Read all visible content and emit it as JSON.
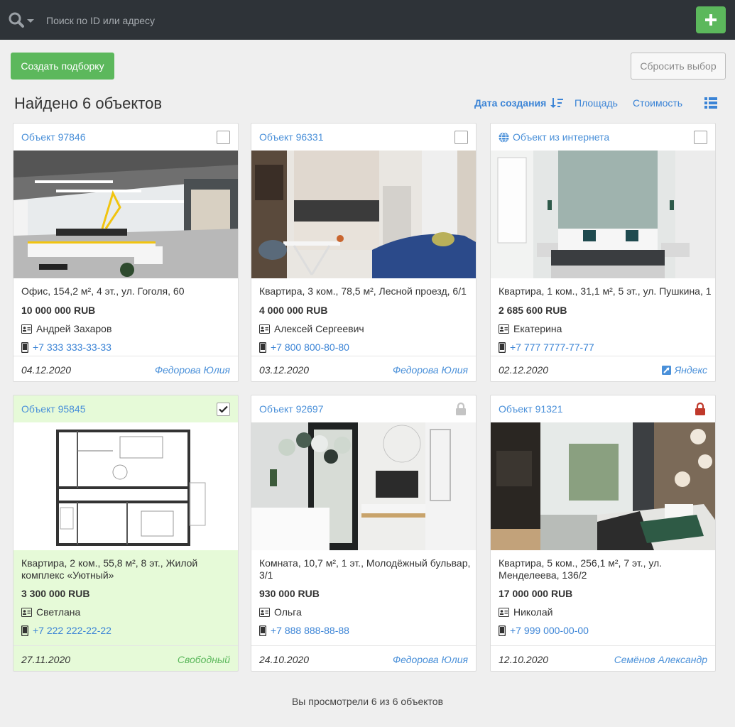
{
  "search": {
    "placeholder": "Поиск по ID или адресу"
  },
  "toolbar": {
    "create_label": "Создать подборку",
    "reset_label": "Сбросить выбор"
  },
  "results": {
    "found_label": "Найдено 6 объектов",
    "viewed_label": "Вы просмотрели 6 из 6 объектов"
  },
  "sort": {
    "active_label": "Дата создания",
    "options": [
      "Площадь",
      "Стоимость"
    ]
  },
  "colors": {
    "topbar": "#2e3338",
    "accent_green": "#5cb85c",
    "link_blue": "#4a90d9",
    "selected_bg": "#e6fad8",
    "lock_red": "#c0392b"
  },
  "cards": [
    {
      "id_label": "Объект 97846",
      "desc": "Офис, 154,2 м², 4 эт., ул. Гоголя, 60",
      "price": "10 000 000 RUB",
      "contact": "Андрей Захаров",
      "phone": "+7 333 333-33-33",
      "date": "04.12.2020",
      "agent": "Федорова Юлия",
      "selected": false,
      "lock": "none",
      "source": "none",
      "image_type": "office"
    },
    {
      "id_label": "Объект 96331",
      "desc": "Квартира, 3 ком., 78,5 м², Лесной проезд, 6/1",
      "price": "4 000 000 RUB",
      "contact": "Алексей Сергеевич",
      "phone": "+7 800 800-80-80",
      "date": "03.12.2020",
      "agent": "Федорова Юлия",
      "selected": false,
      "lock": "none",
      "source": "none",
      "image_type": "kitchen"
    },
    {
      "id_label": "Объект из интернета",
      "desc": "Квартира, 1 ком., 31,1 м², 5 эт.,  ул. Пушкина, 1",
      "price": "2 685 600 RUB",
      "contact": "Екатерина",
      "phone": "+7 777 7777-77-77",
      "date": "02.12.2020",
      "agent": "Яндекс",
      "selected": false,
      "lock": "none",
      "source": "internet",
      "image_type": "bedroom"
    },
    {
      "id_label": "Объект 95845",
      "desc": "Квартира, 2 ком., 55,8 м², 8 эт., Жилой комплекс «Уютный»",
      "price": "3 300 000 RUB",
      "contact": "Светлана",
      "phone": "+7 222 222-22-22",
      "date": "27.11.2020",
      "agent": "Свободный",
      "selected": true,
      "lock": "none",
      "source": "none",
      "image_type": "plan"
    },
    {
      "id_label": "Объект 92697",
      "desc": "Комната, 10,7 м², 1 эт., Молодёжный бульвар, 3/1",
      "price": "930 000 RUB",
      "contact": "Ольга",
      "phone": "+7 888 888-88-88",
      "date": "24.10.2020",
      "agent": "Федорова Юлия",
      "selected": false,
      "lock": "grey",
      "source": "none",
      "image_type": "living"
    },
    {
      "id_label": "Объект 91321",
      "desc": "Квартира, 5 ком., 256,1 м², 7 эт., ул. Менделеева, 136/2",
      "price": "17 000 000 RUB",
      "contact": "Николай",
      "phone": "+7 999 000-00-00",
      "date": "12.10.2020",
      "agent": "Семёнов Александр",
      "selected": false,
      "lock": "red",
      "source": "none",
      "image_type": "bedroom2"
    }
  ]
}
